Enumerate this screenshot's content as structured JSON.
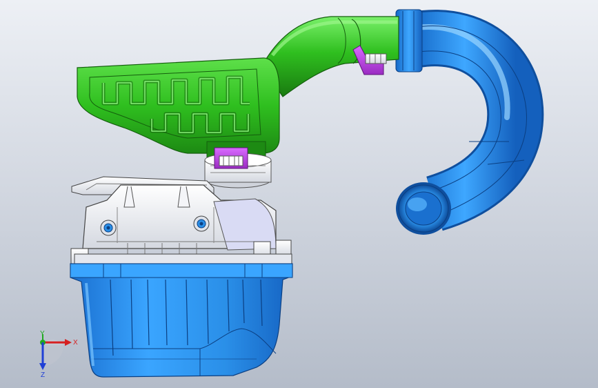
{
  "viewport": {
    "background_top": "#edf0f5",
    "background_bottom": "#b4bcc9"
  },
  "model": {
    "parts": [
      {
        "name": "air-duct",
        "color": "#2fbf1f"
      },
      {
        "name": "intake-pipe-bend",
        "color": "#1f86e8"
      },
      {
        "name": "airbox-lower-housing",
        "color": "#2a8fe8"
      },
      {
        "name": "airbox-upper-cover",
        "color": "#e9ebf0"
      },
      {
        "name": "connector-clip",
        "color": "#b23fd6"
      }
    ]
  },
  "triad": {
    "x_label": "X",
    "y_label": "Y",
    "z_label": "Z",
    "x_color": "#d62020",
    "y_color": "#1faa1f",
    "z_color": "#1f3fd6"
  }
}
